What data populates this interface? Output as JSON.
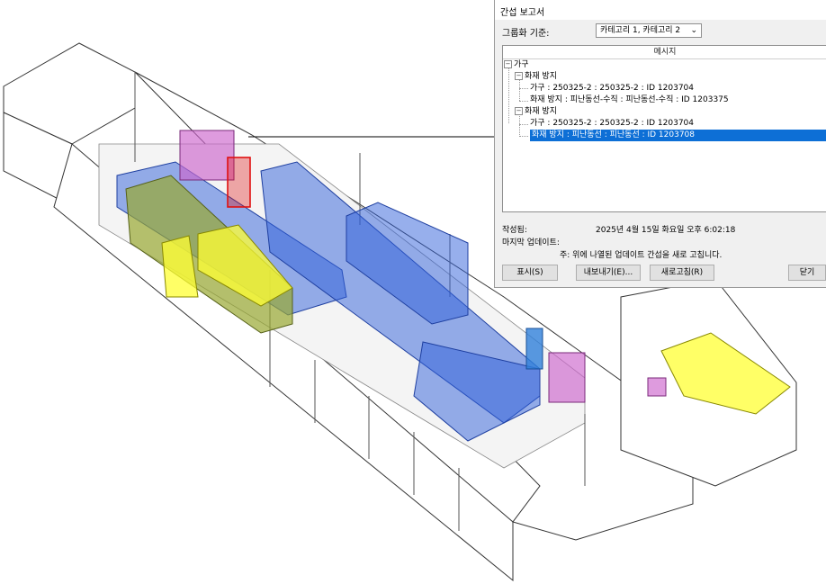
{
  "dialog": {
    "title": "간섭 보고서",
    "group_label": "그룹화 기준:",
    "group_value": "카테고리 1, 카테고리 2",
    "column_header": "메시지",
    "tree": {
      "n1": "가구",
      "n2": "화재 방지",
      "n3": "가구 : 250325-2 : 250325-2 : ID 1203704",
      "n4": "화재 방지 : 피난동선-수직 : 피난동선-수직 : ID 1203375",
      "n5": "화재 방지",
      "n6": "가구 : 250325-2 : 250325-2 : ID 1203704",
      "n7": "화재 방지 : 피난동선 : 피난동선 : ID 1203708"
    },
    "created_label": "작성됨:",
    "created_value": "2025년 4월 15일 화요일 오후 6:02:18",
    "updated_label": "마지막 업데이트:",
    "note": "주: 위에 나열된 업데이트 간섭을 새로 고칩니다.",
    "buttons": {
      "show": "표시(S)",
      "export": "내보내기(E)...",
      "refresh": "새로고침(R)",
      "close": "닫기"
    }
  },
  "colors": {
    "corridor_blue": "#2f5fd9",
    "stair_yellow": "#ffff33",
    "room_olive": "#99a832",
    "column_magenta": "#cc66cc",
    "clash_red": "#e01010",
    "selection_blue": "#0d6fd6"
  }
}
